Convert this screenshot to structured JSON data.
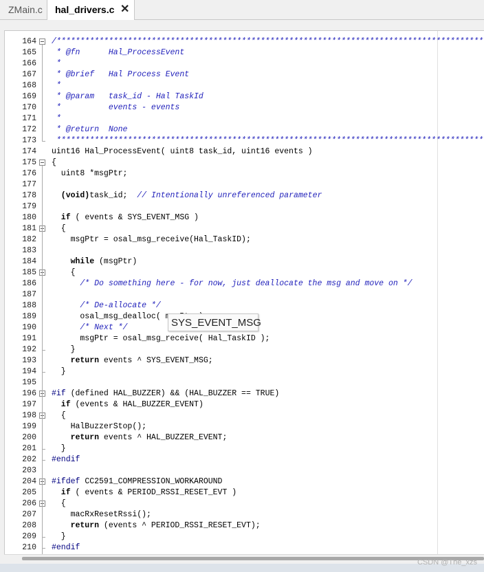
{
  "tabs": [
    {
      "label": "ZMain.c"
    },
    {
      "label": "hal_drivers.c",
      "close": "✕"
    }
  ],
  "tooltip": "SYS_EVENT_MSG",
  "watermark": "CSDN @The_xzs",
  "lines": [
    {
      "n": "164",
      "fold": "open",
      "segs": [
        {
          "t": "/*******************************************************************************************",
          "c": "c"
        }
      ]
    },
    {
      "n": "165",
      "segs": [
        {
          "t": " * @fn      Hal_ProcessEvent",
          "c": "c"
        }
      ]
    },
    {
      "n": "166",
      "segs": [
        {
          "t": " *",
          "c": "c"
        }
      ]
    },
    {
      "n": "167",
      "segs": [
        {
          "t": " * @brief   Hal Process Event",
          "c": "c"
        }
      ]
    },
    {
      "n": "168",
      "segs": [
        {
          "t": " *",
          "c": "c"
        }
      ]
    },
    {
      "n": "169",
      "segs": [
        {
          "t": " * @param   task_id - Hal TaskId",
          "c": "c"
        }
      ]
    },
    {
      "n": "170",
      "segs": [
        {
          "t": " *          events - events",
          "c": "c"
        }
      ]
    },
    {
      "n": "171",
      "segs": [
        {
          "t": " *",
          "c": "c"
        }
      ]
    },
    {
      "n": "172",
      "segs": [
        {
          "t": " * @return  None",
          "c": "c"
        }
      ]
    },
    {
      "n": "173",
      "fold": "end",
      "segs": [
        {
          "t": " ******************************************************************************************",
          "c": "c"
        }
      ]
    },
    {
      "n": "174",
      "segs": [
        {
          "t": "uint16 Hal_ProcessEvent( uint8 task_id, uint16 events )",
          "c": ""
        }
      ]
    },
    {
      "n": "175",
      "fold": "open",
      "segs": [
        {
          "t": "{",
          "c": ""
        }
      ]
    },
    {
      "n": "176",
      "segs": [
        {
          "t": "  uint8 *msgPtr;",
          "c": ""
        }
      ]
    },
    {
      "n": "177",
      "segs": [
        {
          "t": "",
          "c": ""
        }
      ]
    },
    {
      "n": "178",
      "segs": [
        {
          "t": "  (void)",
          "c": "kw"
        },
        {
          "t": "task_id;  ",
          "c": ""
        },
        {
          "t": "// Intentionally unreferenced parameter",
          "c": "c"
        }
      ]
    },
    {
      "n": "179",
      "segs": [
        {
          "t": "",
          "c": ""
        }
      ]
    },
    {
      "n": "180",
      "segs": [
        {
          "t": "  if",
          "c": "kw"
        },
        {
          "t": " ( events & SYS_EVENT_MSG )",
          "c": ""
        }
      ]
    },
    {
      "n": "181",
      "fold": "open",
      "segs": [
        {
          "t": "  {",
          "c": ""
        }
      ]
    },
    {
      "n": "182",
      "segs": [
        {
          "t": "    msgPtr = osal_msg_receive(Hal_TaskID);",
          "c": ""
        }
      ]
    },
    {
      "n": "183",
      "segs": [
        {
          "t": "",
          "c": ""
        }
      ]
    },
    {
      "n": "184",
      "segs": [
        {
          "t": "    while",
          "c": "kw"
        },
        {
          "t": " (msgPtr)",
          "c": ""
        }
      ]
    },
    {
      "n": "185",
      "fold": "open",
      "segs": [
        {
          "t": "    {",
          "c": ""
        }
      ]
    },
    {
      "n": "186",
      "segs": [
        {
          "t": "      /* Do something here - for now, just deallocate the msg and move on */",
          "c": "c"
        }
      ]
    },
    {
      "n": "187",
      "segs": [
        {
          "t": "",
          "c": ""
        }
      ]
    },
    {
      "n": "188",
      "segs": [
        {
          "t": "      /* De-allocate */",
          "c": "c"
        }
      ]
    },
    {
      "n": "189",
      "segs": [
        {
          "t": "      osal_msg_dealloc( msgPtr );",
          "c": ""
        }
      ]
    },
    {
      "n": "190",
      "segs": [
        {
          "t": "      /* Next */",
          "c": "c"
        }
      ]
    },
    {
      "n": "191",
      "segs": [
        {
          "t": "      msgPtr = osal_msg_receive( Hal_TaskID );",
          "c": ""
        }
      ]
    },
    {
      "n": "192",
      "fold": "end",
      "segs": [
        {
          "t": "    }",
          "c": ""
        }
      ]
    },
    {
      "n": "193",
      "segs": [
        {
          "t": "    return",
          "c": "kw"
        },
        {
          "t": " events ^ SYS_EVENT_MSG;",
          "c": ""
        }
      ]
    },
    {
      "n": "194",
      "fold": "end",
      "segs": [
        {
          "t": "  }",
          "c": ""
        }
      ]
    },
    {
      "n": "195",
      "segs": [
        {
          "t": "",
          "c": ""
        }
      ]
    },
    {
      "n": "196",
      "fold": "open",
      "segs": [
        {
          "t": "#if",
          "c": "pp"
        },
        {
          "t": " (defined HAL_BUZZER) && (HAL_BUZZER == TRUE)",
          "c": ""
        }
      ]
    },
    {
      "n": "197",
      "segs": [
        {
          "t": "  if",
          "c": "kw"
        },
        {
          "t": " (events & HAL_BUZZER_EVENT)",
          "c": ""
        }
      ]
    },
    {
      "n": "198",
      "fold": "open",
      "segs": [
        {
          "t": "  {",
          "c": ""
        }
      ]
    },
    {
      "n": "199",
      "segs": [
        {
          "t": "    HalBuzzerStop();",
          "c": ""
        }
      ]
    },
    {
      "n": "200",
      "segs": [
        {
          "t": "    return",
          "c": "kw"
        },
        {
          "t": " events ^ HAL_BUZZER_EVENT;",
          "c": ""
        }
      ]
    },
    {
      "n": "201",
      "fold": "end",
      "segs": [
        {
          "t": "  }",
          "c": ""
        }
      ]
    },
    {
      "n": "202",
      "fold": "end",
      "segs": [
        {
          "t": "#endif",
          "c": "pp"
        }
      ]
    },
    {
      "n": "203",
      "segs": [
        {
          "t": "",
          "c": ""
        }
      ]
    },
    {
      "n": "204",
      "fold": "open",
      "segs": [
        {
          "t": "#ifdef",
          "c": "pp"
        },
        {
          "t": " CC2591_COMPRESSION_WORKAROUND",
          "c": ""
        }
      ]
    },
    {
      "n": "205",
      "segs": [
        {
          "t": "  if",
          "c": "kw"
        },
        {
          "t": " ( events & PERIOD_RSSI_RESET_EVT )",
          "c": ""
        }
      ]
    },
    {
      "n": "206",
      "fold": "open",
      "segs": [
        {
          "t": "  {",
          "c": ""
        }
      ]
    },
    {
      "n": "207",
      "segs": [
        {
          "t": "    macRxResetRssi();",
          "c": ""
        }
      ]
    },
    {
      "n": "208",
      "segs": [
        {
          "t": "    return",
          "c": "kw"
        },
        {
          "t": " (events ^ PERIOD_RSSI_RESET_EVT);",
          "c": ""
        }
      ]
    },
    {
      "n": "209",
      "fold": "end",
      "segs": [
        {
          "t": "  }",
          "c": ""
        }
      ]
    },
    {
      "n": "210",
      "fold": "end",
      "segs": [
        {
          "t": "#endif",
          "c": "pp"
        }
      ]
    }
  ]
}
